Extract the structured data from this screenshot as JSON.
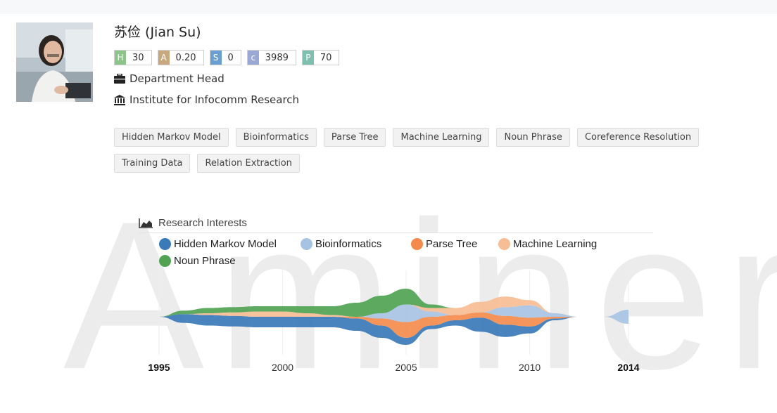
{
  "profile": {
    "name": "苏俭 (Jian Su)",
    "position": "Department Head",
    "affiliation": "Institute for Infocomm Research"
  },
  "metrics": [
    {
      "key": "H",
      "value": "30",
      "color": "#8cc48a"
    },
    {
      "key": "A",
      "value": "0.20",
      "color": "#c8a97f"
    },
    {
      "key": "S",
      "value": "0",
      "color": "#6a9fd1"
    },
    {
      "key": "c",
      "value": "3989",
      "color": "#9aa8d6"
    },
    {
      "key": "P",
      "value": "70",
      "color": "#7fbfb0"
    }
  ],
  "tags": [
    "Hidden Markov Model",
    "Bioinformatics",
    "Parse Tree",
    "Machine Learning",
    "Noun Phrase",
    "Coreference Resolution",
    "Training Data",
    "Relation Extraction"
  ],
  "watermark": "Aminer",
  "chart": {
    "heading": "Research Interests"
  },
  "chart_data": {
    "type": "area",
    "x": [
      1995,
      1996,
      1997,
      1998,
      1999,
      2000,
      2001,
      2002,
      2003,
      2004,
      2005,
      2006,
      2007,
      2008,
      2009,
      2010,
      2011,
      2012,
      2013,
      2014
    ],
    "xticks": [
      "1995",
      "2000",
      "2005",
      "2010",
      "2014"
    ],
    "series": [
      {
        "name": "Hidden Markov Model",
        "color": "#3a7ab8",
        "values": [
          0,
          5,
          6,
          6,
          6,
          6,
          6,
          6,
          7,
          7,
          4,
          2,
          3,
          8,
          7,
          4,
          1,
          0,
          0,
          0
        ]
      },
      {
        "name": "Bioinformatics",
        "color": "#a7c3e3",
        "values": [
          0,
          0,
          0,
          0,
          0,
          0,
          0,
          0,
          0,
          3,
          10,
          3,
          0,
          0,
          5,
          7,
          2,
          0,
          0,
          8
        ]
      },
      {
        "name": "Parse Tree",
        "color": "#f48b4d",
        "values": [
          0,
          0,
          0,
          0,
          0,
          0,
          0,
          0,
          1,
          4,
          9,
          5,
          3,
          3,
          5,
          5,
          1,
          0,
          0,
          0
        ]
      },
      {
        "name": "Machine Learning",
        "color": "#f7bd94",
        "values": [
          0,
          0,
          1,
          2,
          3,
          3,
          2,
          1,
          0,
          0,
          0,
          2,
          4,
          6,
          6,
          3,
          0,
          0,
          0,
          0
        ]
      },
      {
        "name": "Noun Phrase",
        "color": "#51a354",
        "values": [
          0,
          2,
          3,
          3,
          3,
          3,
          4,
          5,
          8,
          10,
          9,
          2,
          0,
          0,
          0,
          0,
          0,
          0,
          0,
          0
        ]
      }
    ]
  }
}
